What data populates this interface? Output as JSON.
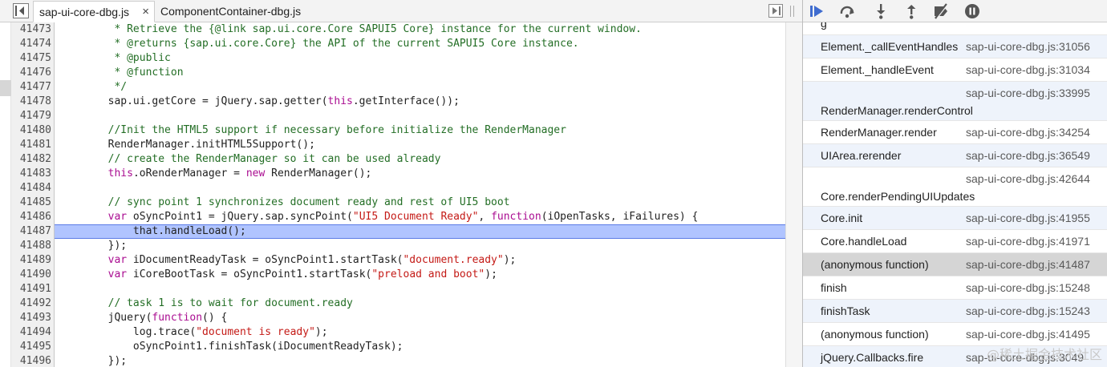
{
  "tabs": [
    {
      "label": "sap-ui-core-dbg.js",
      "active": true,
      "close": "×"
    },
    {
      "label": "ComponentContainer-dbg.js",
      "active": false
    }
  ],
  "editor": {
    "highlight_line": 41487,
    "lines": [
      {
        "n": "41473",
        "tokens": [
          [
            "c",
            "         * Retrieve the {@link sap.ui.core.Core SAPUI5 Core} instance for the current window."
          ]
        ]
      },
      {
        "n": "41474",
        "tokens": [
          [
            "c",
            "         * @returns {sap.ui.core.Core} the API of the current SAPUI5 Core instance."
          ]
        ]
      },
      {
        "n": "41475",
        "tokens": [
          [
            "c",
            "         * @public"
          ]
        ]
      },
      {
        "n": "41476",
        "tokens": [
          [
            "c",
            "         * @function"
          ]
        ]
      },
      {
        "n": "41477",
        "tokens": [
          [
            "c",
            "         */"
          ]
        ]
      },
      {
        "n": "41478",
        "tokens": [
          [
            "p",
            "        sap.ui.getCore = jQuery.sap.getter("
          ],
          [
            "k",
            "this"
          ],
          [
            "p",
            ".getInterface());"
          ]
        ]
      },
      {
        "n": "41479",
        "tokens": []
      },
      {
        "n": "41480",
        "tokens": [
          [
            "c",
            "        //Init the HTML5 support if necessary before initialize the RenderManager"
          ]
        ]
      },
      {
        "n": "41481",
        "tokens": [
          [
            "p",
            "        RenderManager.initHTML5Support();"
          ]
        ]
      },
      {
        "n": "41482",
        "tokens": [
          [
            "c",
            "        // create the RenderManager so it can be used already"
          ]
        ]
      },
      {
        "n": "41483",
        "tokens": [
          [
            "p",
            "        "
          ],
          [
            "k",
            "this"
          ],
          [
            "p",
            ".oRenderManager = "
          ],
          [
            "k",
            "new"
          ],
          [
            "p",
            " RenderManager();"
          ]
        ]
      },
      {
        "n": "41484",
        "tokens": []
      },
      {
        "n": "41485",
        "tokens": [
          [
            "c",
            "        // sync point 1 synchronizes document ready and rest of UI5 boot"
          ]
        ]
      },
      {
        "n": "41486",
        "tokens": [
          [
            "p",
            "        "
          ],
          [
            "k",
            "var"
          ],
          [
            "p",
            " oSyncPoint1 = jQuery.sap.syncPoint("
          ],
          [
            "s",
            "\"UI5 Document Ready\""
          ],
          [
            "p",
            ", "
          ],
          [
            "k",
            "function"
          ],
          [
            "p",
            "(iOpenTasks, iFailures) {"
          ]
        ]
      },
      {
        "n": "41487",
        "tokens": [
          [
            "p",
            "            that.handleLoad();"
          ]
        ]
      },
      {
        "n": "41488",
        "tokens": [
          [
            "p",
            "        });"
          ]
        ]
      },
      {
        "n": "41489",
        "tokens": [
          [
            "p",
            "        "
          ],
          [
            "k",
            "var"
          ],
          [
            "p",
            " iDocumentReadyTask = oSyncPoint1.startTask("
          ],
          [
            "s",
            "\"document.ready\""
          ],
          [
            "p",
            ");"
          ]
        ]
      },
      {
        "n": "41490",
        "tokens": [
          [
            "p",
            "        "
          ],
          [
            "k",
            "var"
          ],
          [
            "p",
            " iCoreBootTask = oSyncPoint1.startTask("
          ],
          [
            "s",
            "\"preload and boot\""
          ],
          [
            "p",
            ");"
          ]
        ]
      },
      {
        "n": "41491",
        "tokens": []
      },
      {
        "n": "41492",
        "tokens": [
          [
            "c",
            "        // task 1 is to wait for document.ready"
          ]
        ]
      },
      {
        "n": "41493",
        "tokens": [
          [
            "p",
            "        jQuery("
          ],
          [
            "k",
            "function"
          ],
          [
            "p",
            "() {"
          ]
        ]
      },
      {
        "n": "41494",
        "tokens": [
          [
            "p",
            "            log.trace("
          ],
          [
            "s",
            "\"document is ready\""
          ],
          [
            "p",
            ");"
          ]
        ]
      },
      {
        "n": "41495",
        "tokens": [
          [
            "p",
            "            oSyncPoint1.finishTask(iDocumentReadyTask);"
          ]
        ]
      },
      {
        "n": "41496",
        "tokens": [
          [
            "p",
            "        });"
          ]
        ]
      }
    ]
  },
  "callstack": [
    {
      "fn": "g",
      "src": "",
      "tall": false,
      "partial_top": true,
      "style": "plain"
    },
    {
      "fn": "Element._callEventHandles",
      "src": "sap-ui-core-dbg.js:31056",
      "tall": false,
      "style": "blue"
    },
    {
      "fn": "Element._handleEvent",
      "src": "sap-ui-core-dbg.js:31034",
      "tall": false,
      "style": "plain"
    },
    {
      "fn": "RenderManager.renderControl",
      "src": "sap-ui-core-dbg.js:33995",
      "tall": true,
      "style": "blue"
    },
    {
      "fn": "RenderManager.render",
      "src": "sap-ui-core-dbg.js:34254",
      "tall": false,
      "style": "plain"
    },
    {
      "fn": "UIArea.rerender",
      "src": "sap-ui-core-dbg.js:36549",
      "tall": false,
      "style": "blue"
    },
    {
      "fn": "Core.renderPendingUIUpdates",
      "src": "sap-ui-core-dbg.js:42644",
      "tall": true,
      "style": "plain"
    },
    {
      "fn": "Core.init",
      "src": "sap-ui-core-dbg.js:41955",
      "tall": false,
      "style": "blue"
    },
    {
      "fn": "Core.handleLoad",
      "src": "sap-ui-core-dbg.js:41971",
      "tall": false,
      "style": "plain"
    },
    {
      "fn": "(anonymous function)",
      "src": "sap-ui-core-dbg.js:41487",
      "tall": false,
      "style": "sel"
    },
    {
      "fn": "finish",
      "src": "sap-ui-core-dbg.js:15248",
      "tall": false,
      "style": "plain"
    },
    {
      "fn": "finishTask",
      "src": "sap-ui-core-dbg.js:15243",
      "tall": false,
      "style": "blue"
    },
    {
      "fn": "(anonymous function)",
      "src": "sap-ui-core-dbg.js:41495",
      "tall": false,
      "style": "plain"
    },
    {
      "fn": "jQuery.Callbacks.fire",
      "src": "sap-ui-core-dbg.js:3049",
      "tall": false,
      "style": "blue"
    }
  ],
  "watermark": "@稀土掘金技术社区",
  "debugger_buttons": [
    "resume-icon",
    "step-over-icon",
    "step-into-icon",
    "step-out-icon",
    "deactivate-breakpoints-icon",
    "pause-on-exceptions-icon"
  ],
  "colors": {
    "accent": "#3f6ccf",
    "highlight": "#b0c4ff",
    "comment": "#236e25",
    "keyword": "#aa0d91",
    "string": "#c41a16"
  }
}
